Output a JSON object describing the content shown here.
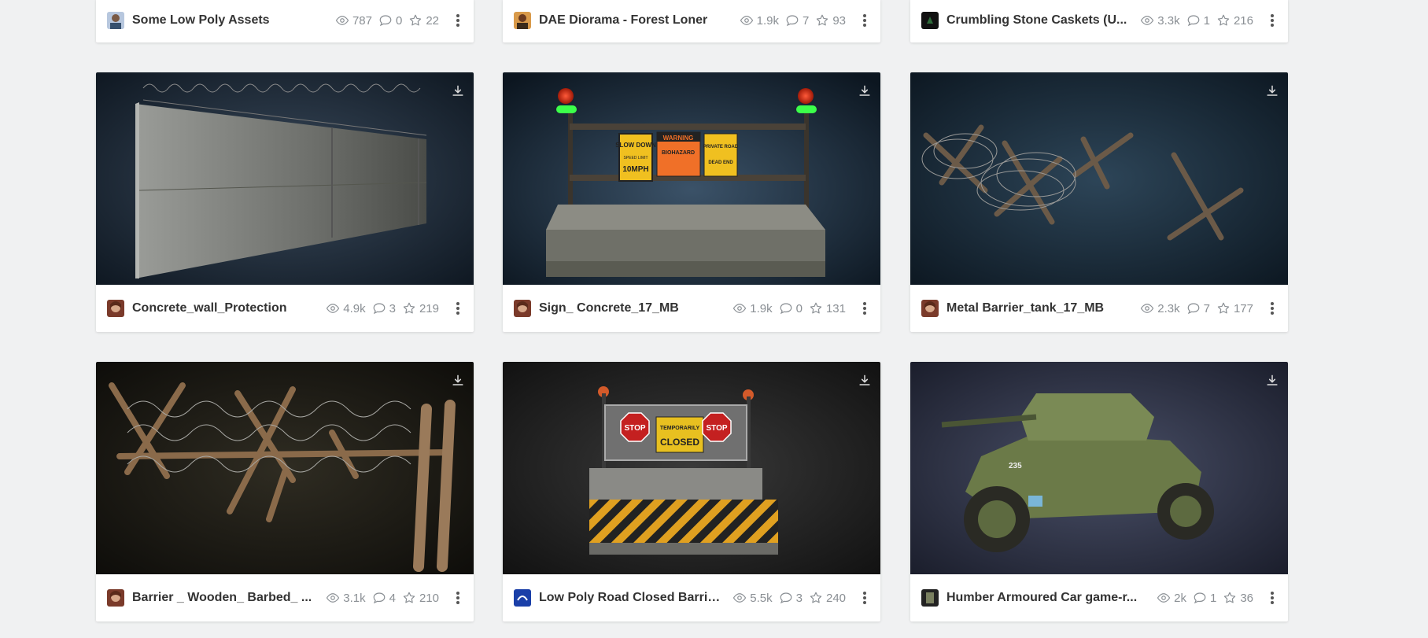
{
  "rows": [
    [
      {
        "title": "Some Low Poly Assets",
        "views": "787",
        "comments": "0",
        "likes": "22"
      },
      {
        "title": "DAE Diorama - Forest Loner",
        "views": "1.9k",
        "comments": "7",
        "likes": "93"
      },
      {
        "title": "Crumbling Stone Caskets (U...",
        "views": "3.3k",
        "comments": "1",
        "likes": "216"
      }
    ],
    [
      {
        "title": "Concrete_wall_Protection",
        "views": "4.9k",
        "comments": "3",
        "likes": "219"
      },
      {
        "title": "Sign_ Concrete_17_MB",
        "views": "1.9k",
        "comments": "0",
        "likes": "131"
      },
      {
        "title": "Metal Barrier_tank_17_MB",
        "views": "2.3k",
        "comments": "7",
        "likes": "177"
      }
    ],
    [
      {
        "title": "Barrier _ Wooden_ Barbed_ ...",
        "views": "3.1k",
        "comments": "4",
        "likes": "210"
      },
      {
        "title": "Low Poly Road Closed Barrie...",
        "views": "5.5k",
        "comments": "3",
        "likes": "240"
      },
      {
        "title": "Humber Armoured Car game-r...",
        "views": "2k",
        "comments": "1",
        "likes": "36"
      }
    ]
  ],
  "thumbnail_text": {
    "slow_down": "SLOW DOWN",
    "speed_limit": "SPEED LIMIT",
    "mph": "10MPH",
    "warning": "WARNING",
    "biohazard": "BIOHAZARD",
    "private_road": "PRIVATE ROAD",
    "dead_end": "DEAD END",
    "stop": "STOP",
    "temporarily": "TEMPORARILY",
    "closed": "CLOSED",
    "vehicle_number": "235"
  },
  "colors": {
    "page_bg": "#f0f1f2",
    "card_bg": "#ffffff",
    "text": "#333333",
    "muted": "#8a8f94"
  }
}
